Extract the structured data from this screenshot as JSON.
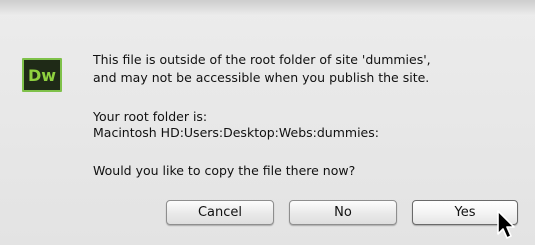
{
  "dialog": {
    "icon_label": "Dw",
    "message_line1": "This file is outside of the root folder of site 'dummies',",
    "message_line2": "and may not be accessible when you publish the site.",
    "root_label": "Your root folder is:",
    "root_path": "Macintosh HD:Users:Desktop:Webs:dummies:",
    "question": "Would you like to copy the file there now?"
  },
  "buttons": {
    "cancel": "Cancel",
    "no": "No",
    "yes": "Yes"
  },
  "colors": {
    "icon_bg": "#1f2a17",
    "icon_accent": "#8fd13f"
  },
  "icons": {
    "app": "dreamweaver-app-icon",
    "pointer": "mouse-pointer-icon"
  }
}
